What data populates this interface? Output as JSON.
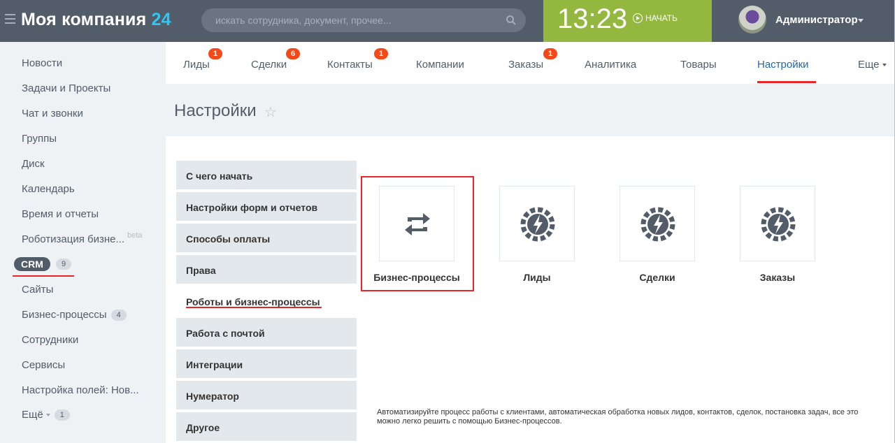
{
  "header": {
    "logo_name": "Моя компания",
    "logo_num": "24",
    "search_placeholder": "искать сотрудника, документ, прочее...",
    "time": "13:23",
    "start_label": "НАЧАТЬ",
    "user_name": "Администратор"
  },
  "sidebar": {
    "items": [
      {
        "label": "Новости"
      },
      {
        "label": "Задачи и Проекты"
      },
      {
        "label": "Чат и звонки"
      },
      {
        "label": "Группы"
      },
      {
        "label": "Диск"
      },
      {
        "label": "Календарь"
      },
      {
        "label": "Время и отчеты"
      },
      {
        "label": "Роботизация бизне...",
        "beta": "beta"
      },
      {
        "label": "Сайты"
      },
      {
        "label": "Бизнес-процессы",
        "count": "4"
      },
      {
        "label": "Сотрудники"
      },
      {
        "label": "Сервисы"
      },
      {
        "label": "Настройка полей: Нов..."
      },
      {
        "label": "Ещё",
        "count": "1"
      }
    ],
    "crm": {
      "label": "CRM",
      "count": "9"
    }
  },
  "tabs": [
    {
      "label": "Лиды",
      "badge": "1"
    },
    {
      "label": "Сделки",
      "badge": "6"
    },
    {
      "label": "Контакты",
      "badge": "1"
    },
    {
      "label": "Компании"
    },
    {
      "label": "Заказы",
      "badge": "1"
    },
    {
      "label": "Аналитика"
    },
    {
      "label": "Товары"
    },
    {
      "label": "Настройки",
      "active": true
    },
    {
      "label": "Еще"
    }
  ],
  "page": {
    "title": "Настройки"
  },
  "menu": [
    {
      "label": "С чего начать"
    },
    {
      "label": "Настройки форм и отчетов"
    },
    {
      "label": "Способы оплаты"
    },
    {
      "label": "Права"
    },
    {
      "label": "Роботы и бизнес-процессы",
      "active": true
    },
    {
      "label": "Работа с почтой"
    },
    {
      "label": "Интеграции"
    },
    {
      "label": "Нумератор"
    },
    {
      "label": "Другое"
    }
  ],
  "tiles": [
    {
      "label": "Бизнес-процессы",
      "icon": "refresh-icon"
    },
    {
      "label": "Лиды",
      "icon": "robot-gear-icon"
    },
    {
      "label": "Сделки",
      "icon": "robot-gear-icon"
    },
    {
      "label": "Заказы",
      "icon": "robot-gear-icon"
    }
  ],
  "description": "Автоматизируйте процесс работы с клиентами, автоматическая обработка новых лидов, контактов, сделок, постановка задач, все это можно легко решить с помощью Бизнес-процессов.",
  "colors": {
    "accent_red": "#e8262a",
    "active_blue": "#2067b0",
    "clock_green": "#93b73f",
    "badge_orange": "#f54819"
  }
}
